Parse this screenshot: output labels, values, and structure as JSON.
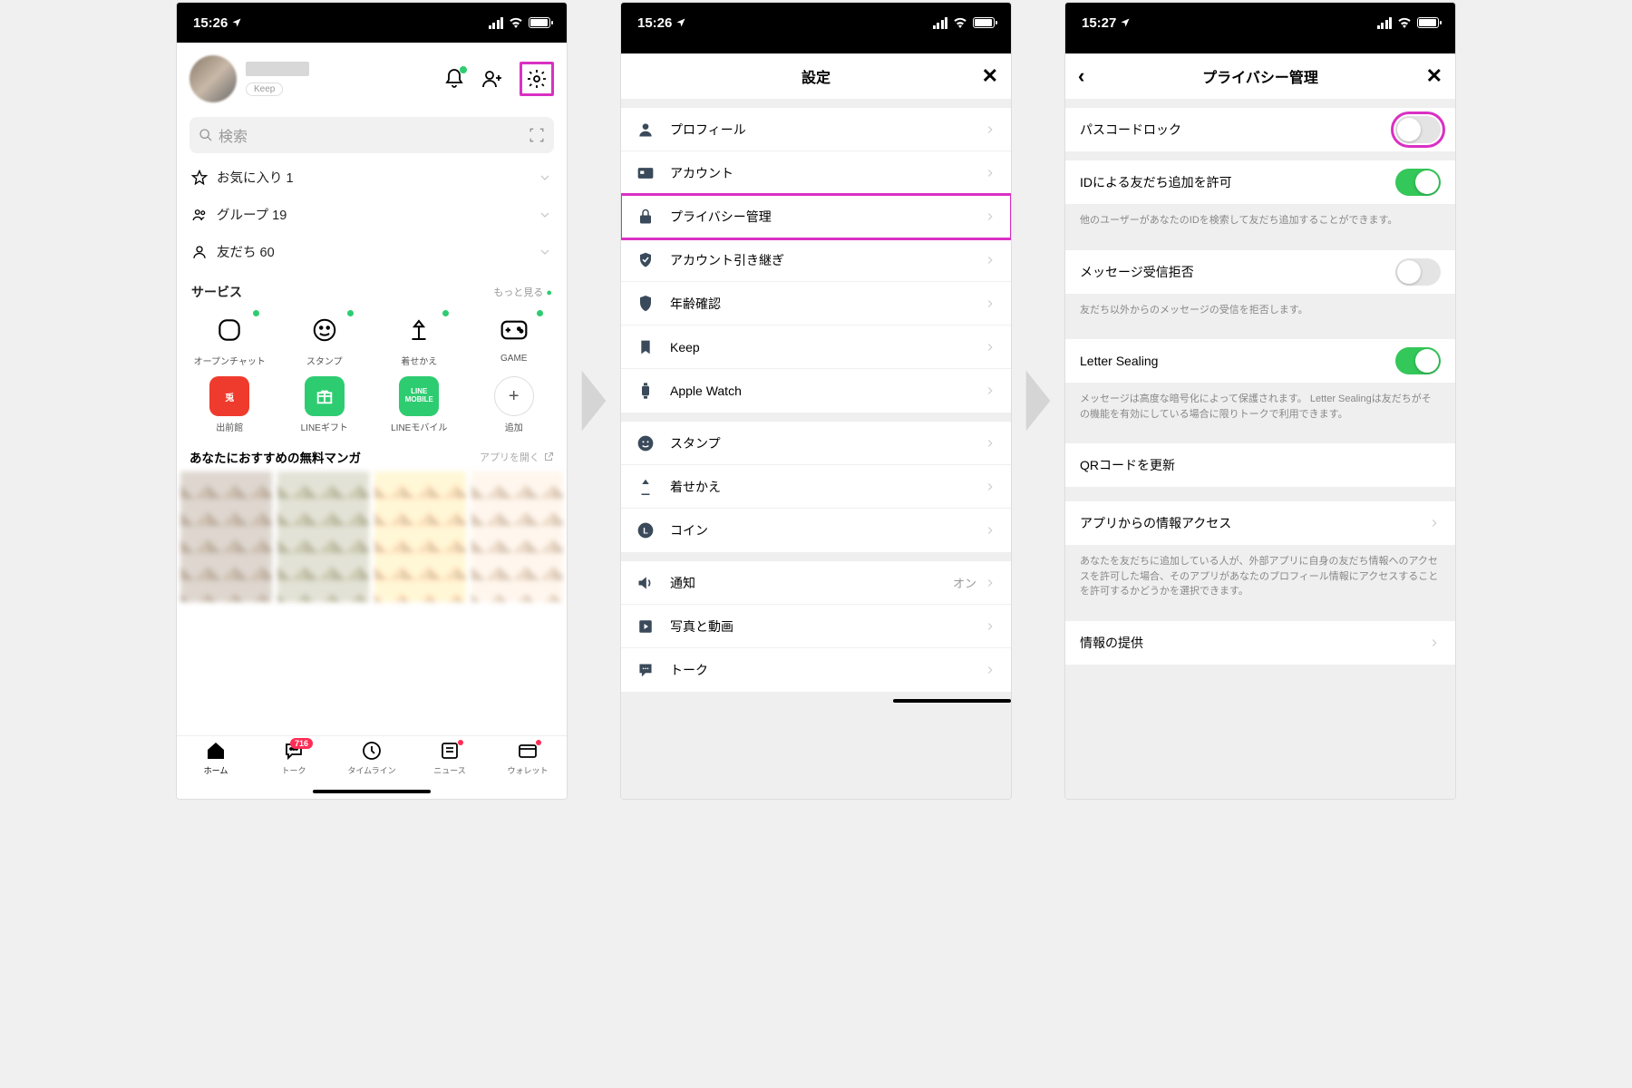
{
  "status": {
    "time1": "15:26",
    "time2": "15:26",
    "time3": "15:27"
  },
  "p1": {
    "keep": "Keep",
    "search": "検索",
    "fav": "お気に入り 1",
    "group": "グループ 19",
    "friend": "友だち 60",
    "svc_title": "サービス",
    "svc_more": "もっと見る",
    "svc": [
      "オープンチャット",
      "スタンプ",
      "着せかえ",
      "GAME",
      "出前館",
      "LINEギフト",
      "LINEモバイル",
      "追加"
    ],
    "rec_title": "あなたにおすすめの無料マンガ",
    "rec_open": "アプリを開く",
    "tabs": [
      "ホーム",
      "トーク",
      "タイムライン",
      "ニュース",
      "ウォレット"
    ],
    "talk_badge": "716"
  },
  "p2": {
    "title": "設定",
    "g1": [
      "プロフィール",
      "アカウント",
      "プライバシー管理",
      "アカウント引き継ぎ",
      "年齢確認",
      "Keep",
      "Apple Watch"
    ],
    "g2": [
      "スタンプ",
      "着せかえ",
      "コイン"
    ],
    "g3": [
      "通知",
      "写真と動画",
      "トーク"
    ],
    "noti_val": "オン"
  },
  "p3": {
    "title": "プライバシー管理",
    "passcode": "パスコードロック",
    "idallow": "IDによる友だち追加を許可",
    "idallow_desc": "他のユーザーがあなたのIDを検索して友だち追加することができます。",
    "msgdeny": "メッセージ受信拒否",
    "msgdeny_desc": "友だち以外からのメッセージの受信を拒否します。",
    "letter": "Letter Sealing",
    "letter_desc": "メッセージは高度な暗号化によって保護されます。 Letter Sealingは友だちがその機能を有効にしている場合に限りトークで利用できます。",
    "qr": "QRコードを更新",
    "access": "アプリからの情報アクセス",
    "access_desc": "あなたを友だちに追加している人が、外部アプリに自身の友だち情報へのアクセスを許可した場合、そのアプリがあなたのプロフィール情報にアクセスすることを許可するかどうかを選択できます。",
    "provide": "情報の提供"
  }
}
